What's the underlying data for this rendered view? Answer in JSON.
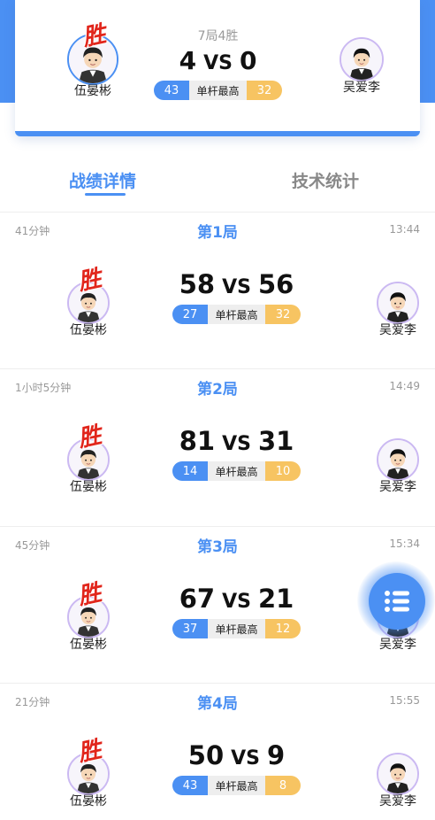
{
  "summary": {
    "match_format": "7局4胜",
    "score_left": "4",
    "vs": "VS",
    "score_right": "0",
    "player_left": "伍晏彬",
    "player_right": "吴爱李",
    "win_mark": "胜",
    "best_break_left": "43",
    "best_break_label": "单杆最高",
    "best_break_right": "32"
  },
  "tabs": [
    {
      "label": "战绩详情",
      "active": true
    },
    {
      "label": "技术统计",
      "active": false
    }
  ],
  "frames": [
    {
      "duration": "41分钟",
      "title": "第1局",
      "time": "13:44",
      "score_left": "58",
      "vs": "VS",
      "score_right": "56",
      "best_left": "27",
      "best_label": "单杆最高",
      "best_right": "32",
      "player_left": "伍晏彬",
      "player_right": "吴爱李",
      "win_mark": "胜"
    },
    {
      "duration": "1小时5分钟",
      "title": "第2局",
      "time": "14:49",
      "score_left": "81",
      "vs": "VS",
      "score_right": "31",
      "best_left": "14",
      "best_label": "单杆最高",
      "best_right": "10",
      "player_left": "伍晏彬",
      "player_right": "吴爱李",
      "win_mark": "胜"
    },
    {
      "duration": "45分钟",
      "title": "第3局",
      "time": "15:34",
      "score_left": "67",
      "vs": "VS",
      "score_right": "21",
      "best_left": "37",
      "best_label": "单杆最高",
      "best_right": "12",
      "player_left": "伍晏彬",
      "player_right": "吴爱李",
      "win_mark": "胜"
    },
    {
      "duration": "21分钟",
      "title": "第4局",
      "time": "15:55",
      "score_left": "50",
      "vs": "VS",
      "score_right": "9",
      "best_left": "43",
      "best_label": "单杆最高",
      "best_right": "8",
      "player_left": "伍晏彬",
      "player_right": "吴爱李",
      "win_mark": "胜"
    }
  ],
  "fab": {
    "icon": "list-menu-icon"
  },
  "colors": {
    "accent": "#4b90f3",
    "win": "#e1251b",
    "opponent_pill": "#f7c462",
    "avatar_ring": "#cbb9f2"
  }
}
